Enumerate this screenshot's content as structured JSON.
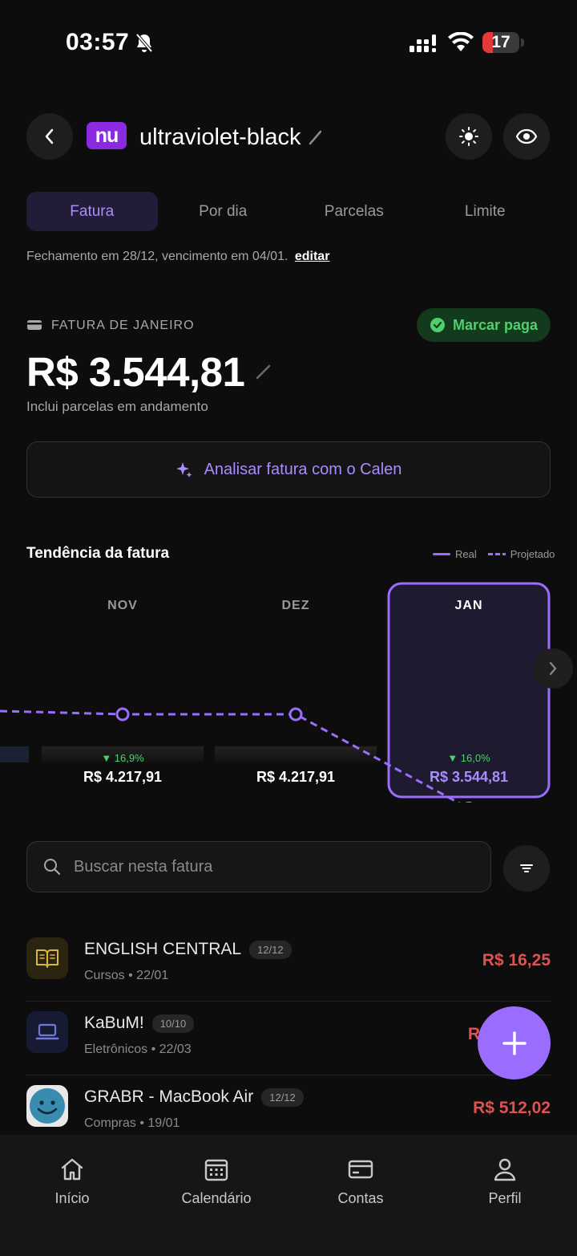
{
  "status_bar": {
    "time": "03:57",
    "battery": "17"
  },
  "header": {
    "card_name": "ultraviolet-black",
    "logo_text": "nu"
  },
  "tabs": [
    {
      "label": "Fatura",
      "active": true
    },
    {
      "label": "Por dia",
      "active": false
    },
    {
      "label": "Parcelas",
      "active": false
    },
    {
      "label": "Limite",
      "active": false
    }
  ],
  "closing_info": {
    "text": "Fechamento em 28/12, vencimento em 04/01.",
    "edit_link": "editar"
  },
  "invoice": {
    "label": "FATURA DE JANEIRO",
    "amount": "R$ 3.544,81",
    "subtitle": "Inclui parcelas em andamento",
    "mark_paid": "Marcar paga"
  },
  "analyze_button": "Analisar fatura com o Calen",
  "trend": {
    "title": "Tendência da fatura",
    "legend_real": "Real",
    "legend_projected": "Projetado"
  },
  "chart_data": {
    "type": "bar",
    "categories": [
      "NOV",
      "DEZ",
      "JAN"
    ],
    "values": [
      4217.91,
      4217.91,
      3544.81
    ],
    "value_labels": [
      "R$ 4.217,91",
      "R$ 4.217,91",
      "R$ 3.544,81"
    ],
    "changes": [
      "16,9%",
      "",
      "16,0%"
    ],
    "selected": "JAN",
    "series": [
      {
        "name": "Real",
        "values": [
          4217.91,
          4217.91,
          3544.81
        ]
      },
      {
        "name": "Projetado",
        "values": [
          4217.91,
          4217.91,
          3544.81
        ]
      }
    ]
  },
  "search": {
    "placeholder": "Buscar nesta fatura"
  },
  "transactions": [
    {
      "name": "ENGLISH CENTRAL",
      "installment": "12/12",
      "subtitle": "Cursos • 22/01",
      "amount": "R$ 16,25",
      "icon": "book-icon"
    },
    {
      "name": "KaBuM!",
      "installment": "10/10",
      "subtitle": "Eletrônicos • 22/03",
      "amount": "R",
      "icon": "laptop-icon"
    },
    {
      "name": "GRABR - MacBook Air",
      "installment": "12/12",
      "subtitle": "Compras • 19/01",
      "amount": "R$ 512,02",
      "icon": "grabr-logo"
    }
  ],
  "nav": [
    {
      "label": "Início",
      "icon": "home-icon"
    },
    {
      "label": "Calendário",
      "icon": "calendar-icon"
    },
    {
      "label": "Contas",
      "icon": "card-icon"
    },
    {
      "label": "Perfil",
      "icon": "user-icon"
    }
  ],
  "colors": {
    "accent": "#9b6dff",
    "background": "#0d0d0d",
    "positive": "#4fd06b",
    "negative": "#e05252",
    "nubank": "#8a2be2"
  }
}
